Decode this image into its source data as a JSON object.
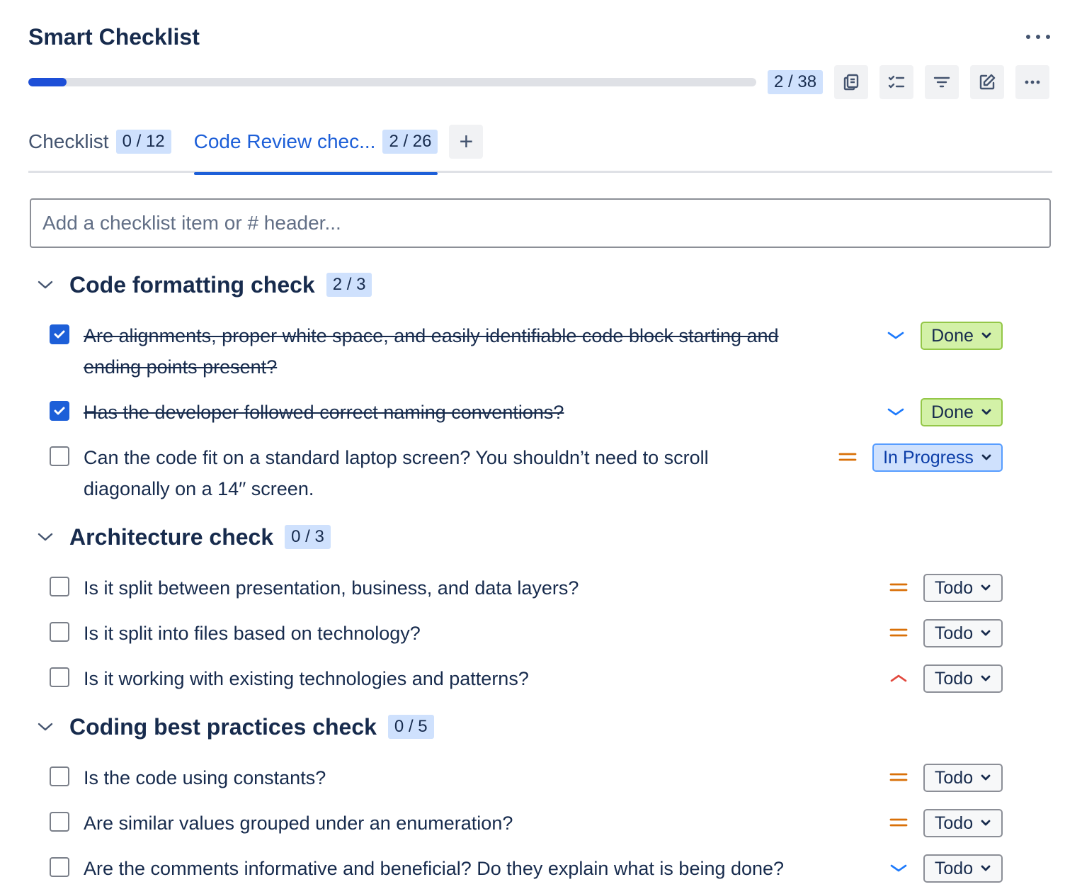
{
  "app": {
    "title": "Smart Checklist"
  },
  "progress": {
    "completed": 2,
    "total": 38,
    "label": "2 / 38"
  },
  "toolbar": [
    "copy-icon",
    "checklist-icon",
    "filter-icon",
    "edit-icon",
    "more-icon"
  ],
  "tabs": [
    {
      "label": "Checklist",
      "count": "0 / 12",
      "active": false
    },
    {
      "label": "Code Review chec...",
      "count": "2 / 26",
      "active": true
    }
  ],
  "add_tab": "+",
  "add_item": {
    "placeholder": "Add a checklist item or # header..."
  },
  "sections": [
    {
      "title": "Code formatting check",
      "count": "2 / 3",
      "items": [
        {
          "line1": "Are alignments, proper white space, and easily identifiable code block starting and",
          "line2": "ending points present?",
          "checked": true,
          "priority": "low",
          "status": "Done"
        },
        {
          "line1": "Has the developer followed correct naming conventions?",
          "line2": "",
          "checked": true,
          "priority": "low",
          "status": "Done"
        },
        {
          "line1": "Can the code fit on a standard laptop screen? You shouldn’t need to scroll",
          "line2": "diagonally on a 14′′ screen.",
          "checked": false,
          "priority": "medium",
          "status": "In Progress"
        }
      ]
    },
    {
      "title": "Architecture check",
      "count": "0 / 3",
      "items": [
        {
          "line1": "Is it split between presentation, business, and data layers?",
          "line2": "",
          "checked": false,
          "priority": "medium",
          "status": "Todo"
        },
        {
          "line1": "Is it split into files based on technology?",
          "line2": "",
          "checked": false,
          "priority": "medium",
          "status": "Todo"
        },
        {
          "line1": "Is it working with existing technologies and patterns?",
          "line2": "",
          "checked": false,
          "priority": "high",
          "status": "Todo"
        }
      ]
    },
    {
      "title": "Coding best practices check",
      "count": "0 / 5",
      "items": [
        {
          "line1": "Is the code using constants?",
          "line2": "",
          "checked": false,
          "priority": "medium",
          "status": "Todo"
        },
        {
          "line1": "Are similar values grouped under an enumeration?",
          "line2": "",
          "checked": false,
          "priority": "medium",
          "status": "Todo"
        },
        {
          "line1": "Are the comments informative and beneficial? Do they explain what is being done?",
          "line2": "",
          "checked": false,
          "priority": "low",
          "status": "Todo"
        }
      ]
    }
  ],
  "colors": {
    "accent": "#1d5fd8",
    "done_bg": "#d3f1a7",
    "progress_bg": "#cfe1fd",
    "priority_medium": "#d97008",
    "priority_high": "#e2483d",
    "priority_low": "#1d7afc"
  }
}
